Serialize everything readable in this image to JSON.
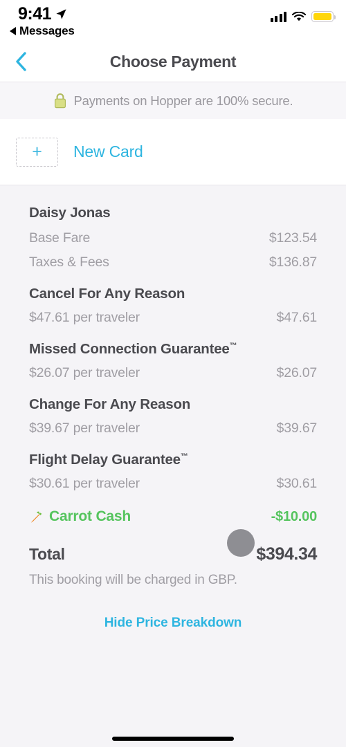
{
  "status_bar": {
    "time": "9:41",
    "back_app_label": "Messages",
    "location_icon": "location-arrow-icon",
    "signal_icon": "cellular-signal-icon",
    "wifi_icon": "wifi-icon",
    "battery_icon": "battery-icon",
    "battery_color": "#ffd60a"
  },
  "nav": {
    "title": "Choose Payment",
    "back_icon": "chevron-left-icon",
    "back_color": "#2eb5e0"
  },
  "secure_banner": {
    "icon": "lock-icon",
    "text": "Payments on Hopper are 100% secure."
  },
  "payment_methods": {
    "new_card": {
      "plus_icon": "plus-icon",
      "label": "New Card"
    }
  },
  "price_breakdown": {
    "traveler_name": "Daisy Jonas",
    "base_rows": [
      {
        "label": "Base Fare",
        "value": "$123.54"
      },
      {
        "label": "Taxes & Fees",
        "value": "$136.87"
      }
    ],
    "addons": [
      {
        "title": "Cancel For Any Reason",
        "trademark": "",
        "label": "$47.61 per traveler",
        "value": "$47.61"
      },
      {
        "title": "Missed Connection Guarantee",
        "trademark": "™",
        "label": "$26.07 per traveler",
        "value": "$26.07"
      },
      {
        "title": "Change For Any Reason",
        "trademark": "",
        "label": "$39.67 per traveler",
        "value": "$39.67"
      },
      {
        "title": "Flight Delay Guarantee",
        "trademark": "™",
        "label": "$30.61 per traveler",
        "value": "$30.61"
      }
    ],
    "carrot_cash": {
      "icon": "carrot-icon",
      "label": "Carrot Cash",
      "value": "-$10.00",
      "color": "#55c45e"
    },
    "total": {
      "label": "Total",
      "value": "$394.34"
    },
    "currency_note": "This booking will be charged in GBP.",
    "hide_link": "Hide Price Breakdown"
  }
}
